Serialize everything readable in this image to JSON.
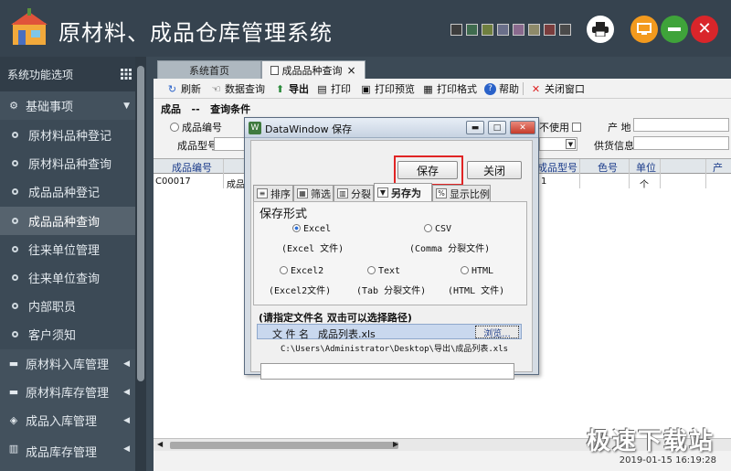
{
  "app": {
    "title": "原材料、成品仓库管理系统",
    "swatches": [
      "#3d3d3d",
      "#3f6b4e",
      "#6f7f3f",
      "#6a6f8a",
      "#8a6a8e",
      "#8e8a6a",
      "#7a3d3d",
      "#4a4a4a"
    ]
  },
  "sidebar": {
    "header": "系统功能选项",
    "items": [
      {
        "label": "基础事项",
        "type": "group",
        "icon": "settings-icon"
      },
      {
        "label": "原材料品种登记",
        "type": "sub"
      },
      {
        "label": "原材料品种查询",
        "type": "sub"
      },
      {
        "label": "成品品种登记",
        "type": "sub"
      },
      {
        "label": "成品品种查询",
        "type": "sub",
        "active": true
      },
      {
        "label": "往来单位管理",
        "type": "sub"
      },
      {
        "label": "往来单位查询",
        "type": "sub"
      },
      {
        "label": "内部职员",
        "type": "sub"
      },
      {
        "label": "客户须知",
        "type": "sub"
      },
      {
        "label": "原材料入库管理",
        "type": "group"
      },
      {
        "label": "原材料库存管理",
        "type": "group"
      },
      {
        "label": "成品入库管理",
        "type": "group"
      },
      {
        "label": "成品库存管理",
        "type": "group"
      }
    ]
  },
  "tabs": [
    {
      "label": "系统首页"
    },
    {
      "label": "成品品种查询",
      "close": "×"
    }
  ],
  "toolbar": {
    "refresh": "刷新",
    "data_query": "数据查询",
    "export": "导出",
    "print": "打印",
    "print_preview": "打印预览",
    "print_format": "打印格式",
    "help": "帮助",
    "close_window": "关闭窗口"
  },
  "criteria": {
    "title_a": "成品",
    "title_sep": "--",
    "title_b": "查询条件",
    "product_code": "成品编号",
    "product_model": "成品型号",
    "unused": "不使用",
    "origin": "产 地",
    "supplier": "供货信息"
  },
  "grid": {
    "headers": [
      "成品编号",
      "成品型号",
      "色号",
      "单位",
      "产"
    ],
    "row": {
      "code": "C00017",
      "col2": "成品",
      "col3": "1",
      "unit": "个"
    }
  },
  "status": {
    "timestamp": "2019-01-15  16:19:28"
  },
  "watermark": "极速下载站",
  "dialog": {
    "title": "DataWindow 保存",
    "save": "保存",
    "close": "关闭",
    "tabs": [
      "排序",
      "筛选",
      "分裂",
      "另存为",
      "显示比例"
    ],
    "format_title": "保存形式",
    "options": [
      {
        "name": "Excel",
        "desc": "(Excel 文件)",
        "checked": true
      },
      {
        "name": "CSV",
        "desc": "(Comma 分裂文件)"
      },
      {
        "name": "Excel2",
        "desc": "(Excel2文件)"
      },
      {
        "name": "Text",
        "desc": "(Tab 分裂文件)"
      },
      {
        "name": "HTML",
        "desc": "(HTML 文件)"
      }
    ],
    "path_hint": "(请指定文件名   双击可以选择路径)",
    "fname_label": "文 件 名",
    "fname_value": "成品列表.xls",
    "browse": "浏览...",
    "fpath": "C:\\Users\\Administrator\\Desktop\\导出\\成品列表.xls"
  }
}
